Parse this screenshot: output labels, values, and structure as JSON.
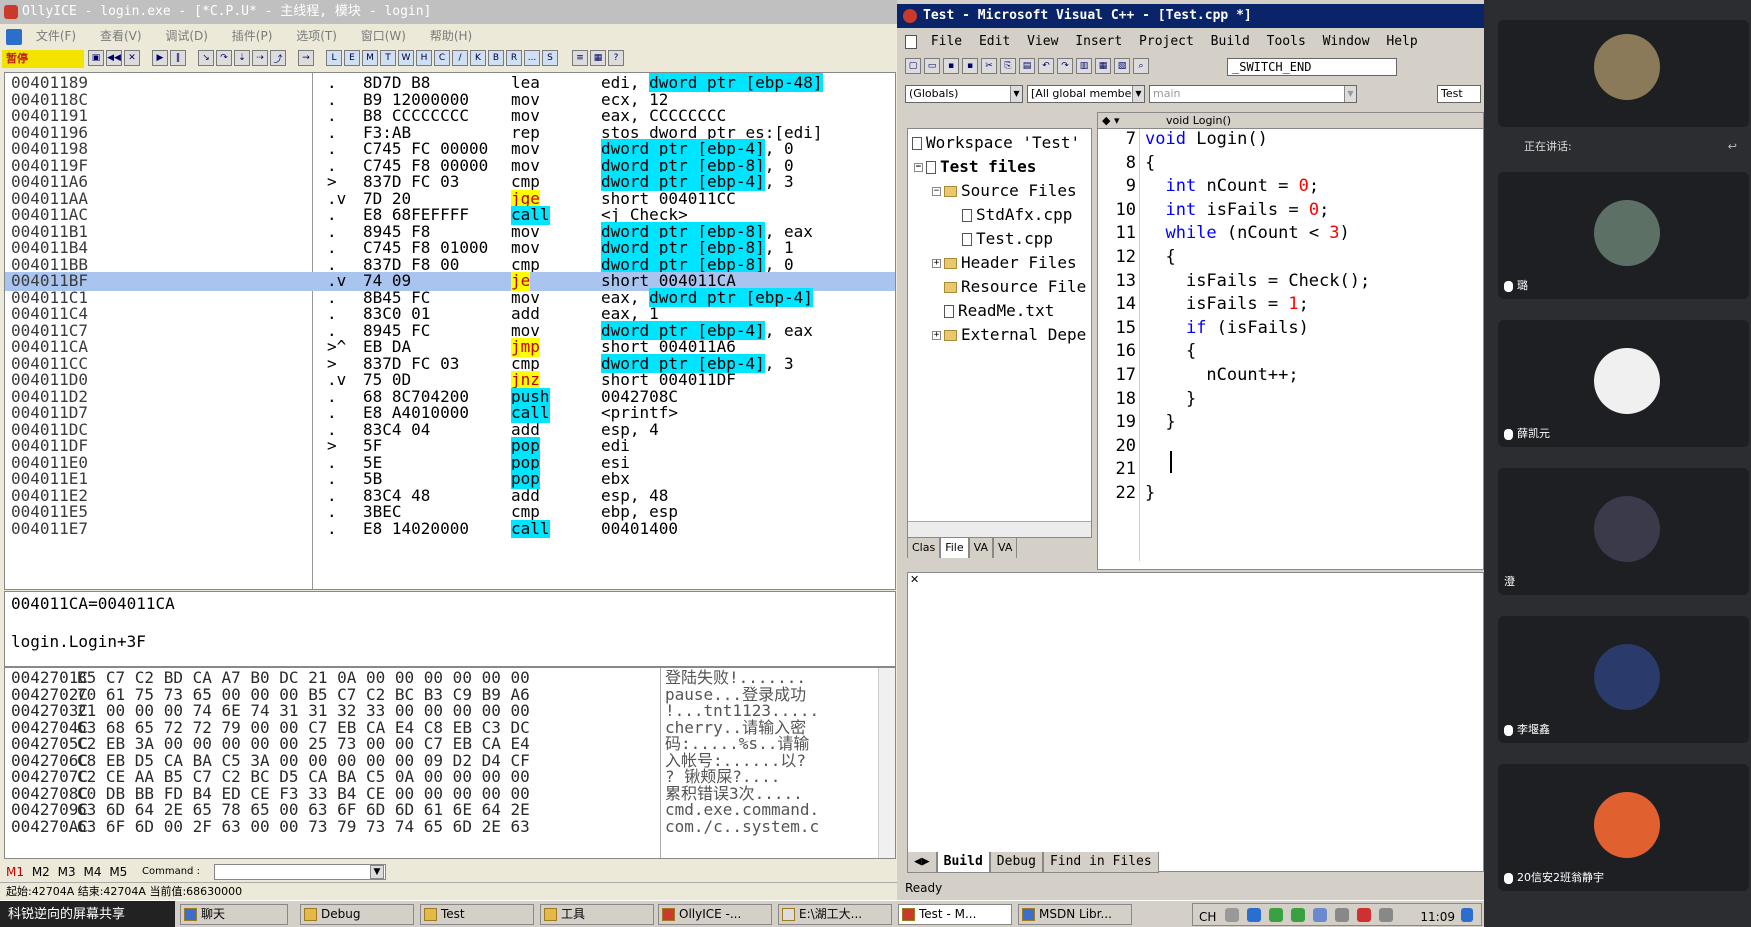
{
  "olly": {
    "title": "OllyICE - login.exe - [*C.P.U* -  主线程, 模块 - login]",
    "menus": [
      "文件(F)",
      "查看(V)",
      "调试(D)",
      "插件(P)",
      "选项(T)",
      "窗口(W)",
      "帮助(H)"
    ],
    "pause_label": "暂停",
    "letter_buttons": [
      "L",
      "E",
      "M",
      "T",
      "W",
      "H",
      "C",
      "/",
      "K",
      "B",
      "R",
      "...",
      "S"
    ],
    "disasm": [
      {
        "addr": "00401189",
        "mark": ".",
        "hex": "8D7D B8",
        "mnem": "lea",
        "ops": "edi, dword ptr [ebp-48]"
      },
      {
        "addr": "0040118C",
        "mark": ".",
        "hex": "B9 12000000",
        "mnem": "mov",
        "ops": "ecx, 12"
      },
      {
        "addr": "00401191",
        "mark": ".",
        "hex": "B8 CCCCCCCC",
        "mnem": "mov",
        "ops": "eax, CCCCCCCC"
      },
      {
        "addr": "00401196",
        "mark": ".",
        "hex": "F3:AB",
        "mnem": "rep",
        "ops": "stos dword ptr es:[edi]"
      },
      {
        "addr": "00401198",
        "mark": ".",
        "hex": "C745 FC 00000",
        "mnem": "mov",
        "ops": "dword ptr [ebp-4], 0"
      },
      {
        "addr": "0040119F",
        "mark": ".",
        "hex": "C745 F8 00000",
        "mnem": "mov",
        "ops": "dword ptr [ebp-8], 0"
      },
      {
        "addr": "004011A6",
        "mark": ">",
        "hex": "837D FC 03",
        "mnem": "cmp",
        "ops": "dword ptr [ebp-4], 3"
      },
      {
        "addr": "004011AA",
        "mark": ".v",
        "hex": "7D 20",
        "mnem": "jge",
        "ops": "short 004011CC"
      },
      {
        "addr": "004011AC",
        "mark": ".",
        "hex": "E8 68FEFFFF",
        "mnem": "call",
        "ops": "<j_Check>"
      },
      {
        "addr": "004011B1",
        "mark": ".",
        "hex": "8945 F8",
        "mnem": "mov",
        "ops": "dword ptr [ebp-8], eax"
      },
      {
        "addr": "004011B4",
        "mark": ".",
        "hex": "C745 F8 01000",
        "mnem": "mov",
        "ops": "dword ptr [ebp-8], 1"
      },
      {
        "addr": "004011BB",
        "mark": ".",
        "hex": "837D F8 00",
        "mnem": "cmp",
        "ops": "dword ptr [ebp-8], 0"
      },
      {
        "addr": "004011BF",
        "mark": ".v",
        "hex": "74 09",
        "mnem": "je",
        "ops": "short 004011CA"
      },
      {
        "addr": "004011C1",
        "mark": ".",
        "hex": "8B45 FC",
        "mnem": "mov",
        "ops": "eax, dword ptr [ebp-4]"
      },
      {
        "addr": "004011C4",
        "mark": ".",
        "hex": "83C0 01",
        "mnem": "add",
        "ops": "eax, 1"
      },
      {
        "addr": "004011C7",
        "mark": ".",
        "hex": "8945 FC",
        "mnem": "mov",
        "ops": "dword ptr [ebp-4], eax"
      },
      {
        "addr": "004011CA",
        "mark": ">^",
        "hex": "EB DA",
        "mnem": "jmp",
        "ops": "short 004011A6"
      },
      {
        "addr": "004011CC",
        "mark": ">",
        "hex": "837D FC 03",
        "mnem": "cmp",
        "ops": "dword ptr [ebp-4], 3"
      },
      {
        "addr": "004011D0",
        "mark": ".v",
        "hex": "75 0D",
        "mnem": "jnz",
        "ops": "short 004011DF"
      },
      {
        "addr": "004011D2",
        "mark": ".",
        "hex": "68 8C704200",
        "mnem": "push",
        "ops": "0042708C"
      },
      {
        "addr": "004011D7",
        "mark": ".",
        "hex": "E8 A4010000",
        "mnem": "call",
        "ops": "<printf>"
      },
      {
        "addr": "004011DC",
        "mark": ".",
        "hex": "83C4 04",
        "mnem": "add",
        "ops": "esp, 4"
      },
      {
        "addr": "004011DF",
        "mark": ">",
        "hex": "5F",
        "mnem": "pop",
        "ops": "edi"
      },
      {
        "addr": "004011E0",
        "mark": ".",
        "hex": "5E",
        "mnem": "pop",
        "ops": "esi"
      },
      {
        "addr": "004011E1",
        "mark": ".",
        "hex": "5B",
        "mnem": "pop",
        "ops": "ebx"
      },
      {
        "addr": "004011E2",
        "mark": ".",
        "hex": "83C4 48",
        "mnem": "add",
        "ops": "esp, 48"
      },
      {
        "addr": "004011E5",
        "mark": ".",
        "hex": "3BEC",
        "mnem": "cmp",
        "ops": "ebp, esp"
      },
      {
        "addr": "004011E7",
        "mark": ".",
        "hex": "E8 14020000",
        "mnem": "call",
        "ops": "00401400"
      }
    ],
    "info_line1": "004011CA=004011CA",
    "info_line2": "login.Login+3F",
    "dump": [
      {
        "addr": "0042701C",
        "hex": "B5 C7 C2 BD CA A7 B0 DC 21 0A 00 00 00 00 00 00",
        "text": "登陆失败!......."
      },
      {
        "addr": "0042702C",
        "hex": "70 61 75 73 65 00 00 00 B5 C7 C2 BC B3 C9 B9 A6",
        "text": "pause...登录成功"
      },
      {
        "addr": "0042703C",
        "hex": "21 00 00 00 74 6E 74 31 31 32 33 00 00 00 00 00",
        "text": "!...tnt1123....."
      },
      {
        "addr": "0042704C",
        "hex": "63 68 65 72 72 79 00 00 C7 EB CA E4 C8 EB C3 DC",
        "text": "cherry..请输入密"
      },
      {
        "addr": "0042705C",
        "hex": "C2 EB 3A 00 00 00 00 00 25 73 00 00 C7 EB CA E4",
        "text": "码:.....%s..请输"
      },
      {
        "addr": "0042706C",
        "hex": "C8 EB D5 CA BA C5 3A 00 00 00 00 00 09 D2 D4 CF",
        "text": "入帐号:......以?"
      },
      {
        "addr": "0042707C",
        "hex": "C2 CE AA B5 C7 C2 BC D5 CA BA C5 0A 00 00 00 00",
        "text": "?  锹颊屎?...."
      },
      {
        "addr": "0042708C",
        "hex": "C0 DB BB FD B4 ED CE F3 33 B4 CE 00 00 00 00 00",
        "text": "累积错误3次....."
      },
      {
        "addr": "0042709C",
        "hex": "63 6D 64 2E 65 78 65 00 63 6F 6D 6D 61 6E 64 2E",
        "text": "cmd.exe.command."
      },
      {
        "addr": "004270AC",
        "hex": "63 6F 6D 00 2F 63 00 00 73 79 73 74 65 6D 2E 63",
        "text": "com./c..system.c"
      }
    ],
    "cmd_marks": [
      "M1",
      "M2",
      "M3",
      "M4",
      "M5"
    ],
    "cmd_label": "Command :",
    "status": "起始:42704A 结束:42704A 当前值:68630000"
  },
  "vc": {
    "title": "Test - Microsoft Visual C++ - [Test.cpp *]",
    "menus": [
      "File",
      "Edit",
      "View",
      "Insert",
      "Project",
      "Build",
      "Tools",
      "Window",
      "Help"
    ],
    "switch_value": "_SWITCH_END",
    "combo_globals": "(Globals)",
    "combo_members": "[All global members",
    "combo_main": "main",
    "combo_test": "Test",
    "func_bar": "void Login()",
    "workspace": {
      "root": "Workspace 'Test'",
      "project": "Test files",
      "source_folder": "Source Files",
      "file1": "StdAfx.cpp",
      "file2": "Test.cpp",
      "header_folder": "Header Files",
      "resource_folder": "Resource File",
      "readme": "ReadMe.txt",
      "external": "External Depe"
    },
    "ws_tabs": [
      "Clas",
      "File",
      "VA",
      "VA"
    ],
    "line_numbers": [
      "7",
      "8",
      "9",
      "10",
      "11",
      "12",
      "13",
      "14",
      "15",
      "16",
      "17",
      "18",
      "19",
      "20",
      "21",
      "22"
    ],
    "code": [
      "void Login()",
      "{",
      "  int nCount = 0;",
      "  int isFails = 0;",
      "  while (nCount < 3)",
      "  {",
      "    isFails = Check();",
      "    isFails = 1;",
      "    if (isFails)",
      "    {",
      "      nCount++;",
      "    }",
      "  }",
      "",
      "",
      "}"
    ],
    "out_tabs": [
      "Build",
      "Debug",
      "Find in Files"
    ],
    "status": "Ready"
  },
  "meeting": {
    "speaking_label": "正在讲话:",
    "participants": [
      {
        "name": "",
        "color": "#8a7a5a"
      },
      {
        "name": "璐",
        "color": "#5d7066"
      },
      {
        "name": "薛凯元",
        "color": "#f0f0f0"
      },
      {
        "name": "澄",
        "color": "#3a3a4a"
      },
      {
        "name": "李堰鑫",
        "color": "#2a3a6a"
      },
      {
        "name": "20信安2班翁静宇",
        "color": "#e06030"
      }
    ]
  },
  "taskbar": {
    "share": "科锐逆向的屏幕共享",
    "items": [
      "聊天",
      "Debug",
      "Test",
      "工具",
      "OllyICE -...",
      "E:\\湖工大...",
      "Test - M...",
      "MSDN Libr..."
    ],
    "ime": "CH",
    "clock": "11:09"
  }
}
